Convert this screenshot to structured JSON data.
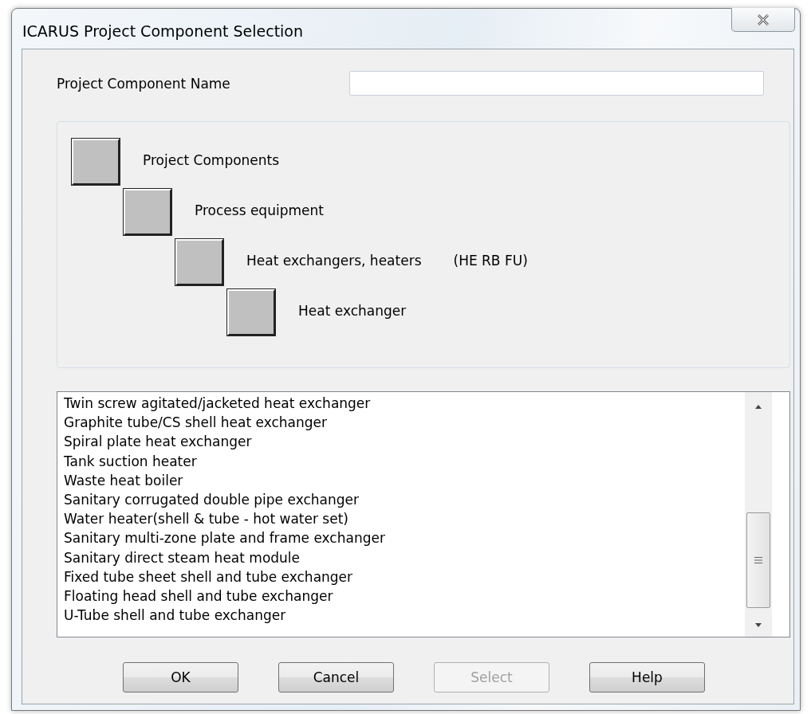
{
  "window": {
    "title": "ICARUS Project Component Selection"
  },
  "name_field": {
    "label": "Project Component Name"
  },
  "tree": [
    {
      "label": "Project Components",
      "children": [
        {
          "label": "Process equipment",
          "children": [
            {
              "label": "Heat exchangers, heaters",
              "code": "(HE RB FU)",
              "children": [
                {
                  "label": "Heat exchanger"
                }
              ]
            }
          ]
        }
      ]
    }
  ],
  "list": {
    "items": [
      {
        "label": "Twin screw agitated/jacketed heat exchanger",
        "selected": false
      },
      {
        "label": "Graphite tube/CS shell heat exchanger",
        "selected": false
      },
      {
        "label": "Spiral plate heat exchanger",
        "selected": false
      },
      {
        "label": "Tank suction heater",
        "selected": false
      },
      {
        "label": "Waste heat boiler",
        "selected": false
      },
      {
        "label": "Sanitary corrugated double pipe exchanger",
        "selected": false
      },
      {
        "label": "Water heater(shell & tube - hot water set)",
        "selected": false
      },
      {
        "label": "Sanitary multi-zone plate and frame exchanger",
        "selected": false
      },
      {
        "label": "Sanitary direct steam heat module",
        "selected": false
      },
      {
        "label": "Fixed tube sheet shell and tube exchanger",
        "selected": false
      },
      {
        "label": "Floating head shell and tube exchanger",
        "selected": false
      },
      {
        "label": "U-Tube shell and tube exchanger",
        "selected": false
      }
    ]
  },
  "buttons": [
    {
      "label": "OK",
      "disabled": false
    },
    {
      "label": "Cancel",
      "disabled": false
    },
    {
      "label": "Select",
      "disabled": true
    },
    {
      "label": "Help",
      "disabled": false
    }
  ]
}
